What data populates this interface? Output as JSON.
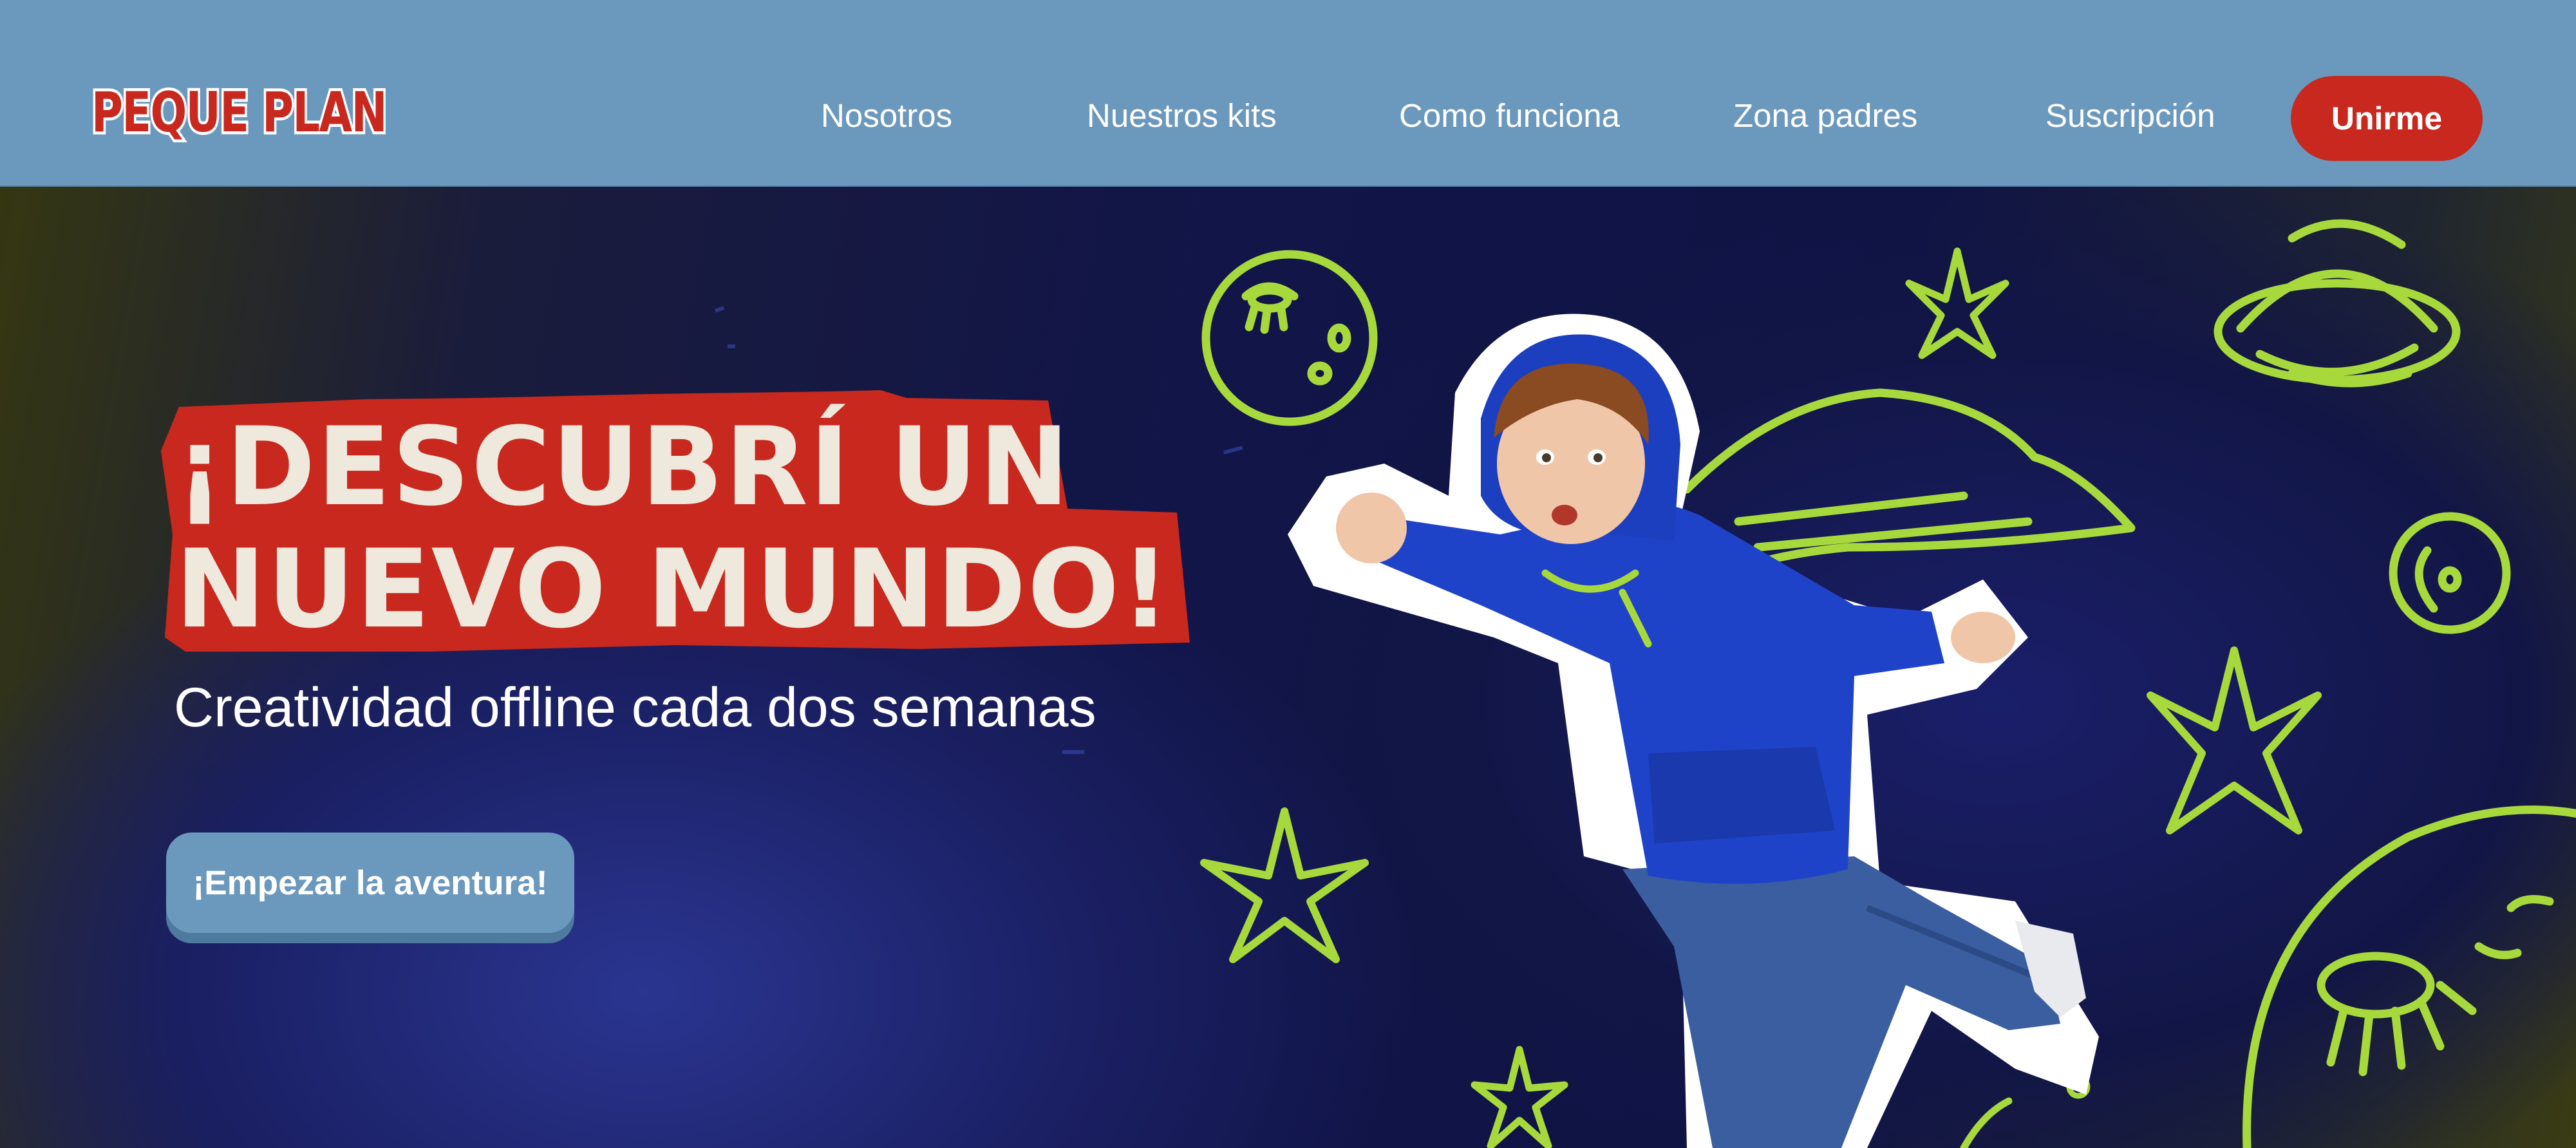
{
  "brand": {
    "logo_text": "PEQUE PLAN",
    "logo_color": "#c8281e"
  },
  "nav": {
    "links": [
      "Nosotros",
      "Nuestros kits",
      "Como funciona",
      "Zona padres",
      "Suscripción"
    ],
    "join_label": "Unirme"
  },
  "hero": {
    "headline_line1": "¡DESCUBRÍ UN",
    "headline_line2": "NUEVO MUNDO!",
    "subtitle": "Creatividad offline cada dos semanas",
    "cta_label": "¡Empezar la aventura!"
  },
  "colors": {
    "header_bg": "#6b98bd",
    "accent_red": "#c8281e",
    "headline_text": "#efe8dc",
    "doodle_green": "#a8d93c",
    "hero_bg": "#141a4a"
  },
  "icons": [
    "star-icon",
    "planet-icon",
    "ufo-icon",
    "cape-icon"
  ]
}
